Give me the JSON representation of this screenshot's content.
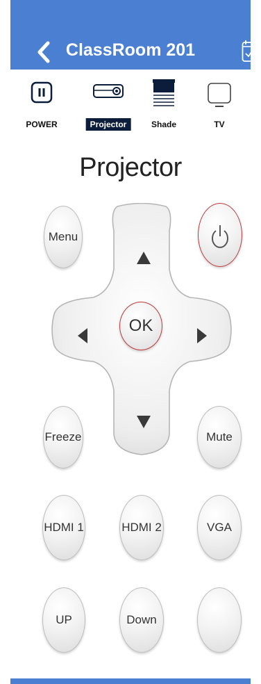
{
  "header": {
    "title": "ClassRoom 201",
    "back_icon": "chevron-left-icon",
    "schedule_icon": "calendar-check-icon",
    "color": "#4a7fd1"
  },
  "tabs": [
    {
      "label": "POWER",
      "icon": "pause-power-icon",
      "active": false
    },
    {
      "label": "Projector",
      "icon": "projector-icon",
      "active": true
    },
    {
      "label": "Shade",
      "icon": "shade-icon",
      "active": false
    },
    {
      "label": "TV",
      "icon": "tv-icon",
      "active": false
    }
  ],
  "section": {
    "title": "Projector"
  },
  "controls": {
    "menu": "Menu",
    "power_icon": "power-icon",
    "ok": "OK",
    "up_icon": "triangle-up-icon",
    "down_icon": "triangle-down-icon",
    "left_icon": "triangle-left-icon",
    "right_icon": "triangle-right-icon",
    "freeze": "Freeze",
    "mute": "Mute",
    "hdmi1": "HDMI 1",
    "hdmi2": "HDMI 2",
    "vga": "VGA",
    "up": "UP",
    "down": "Down",
    "blank": ""
  },
  "colors": {
    "accent": "#4a7fd1",
    "active_tab": "#0b1d3a",
    "power_ring": "#c0393b"
  }
}
